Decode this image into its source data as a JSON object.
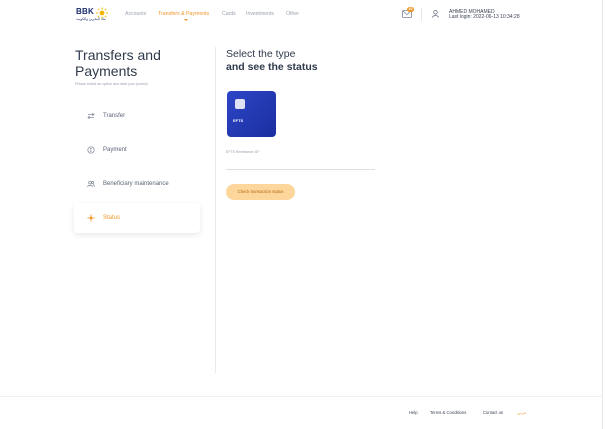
{
  "header": {
    "logo_text": "BBK",
    "logo_arabic": "بنك البحرين والكويت",
    "nav": [
      {
        "label": "Accounts"
      },
      {
        "label": "Transfers & Payments"
      },
      {
        "label": "Cards"
      },
      {
        "label": "Investments"
      },
      {
        "label": "Other"
      }
    ],
    "mail_badge": "10",
    "user_name": "AHMED MOHAMED",
    "last_login": "Last login: 2022-06-13 10:34:28"
  },
  "sidebar": {
    "title": "Transfers and Payments",
    "subtitle": "Please select an option and start your journey",
    "items": [
      {
        "label": "Transfer",
        "icon": "transfer-arrows-icon"
      },
      {
        "label": "Payment",
        "icon": "payment-icon"
      },
      {
        "label": "Beneficiary maintenance",
        "icon": "users-icon"
      },
      {
        "label": "Status",
        "icon": "status-icon"
      }
    ]
  },
  "main": {
    "title_line1": "Select the type",
    "title_line2": "and see the status",
    "card_label": "EFTS",
    "card_caption": "EFTS Remittance ID*",
    "check_button": "Check transaction status"
  },
  "footer": {
    "help": "Help",
    "terms": "Terms & Conditions",
    "contact": "Contact us",
    "language": "عربي"
  },
  "colors": {
    "accent": "#f0962a",
    "brand_blue": "#1a2e9e",
    "button_bg": "#fdd69b"
  }
}
